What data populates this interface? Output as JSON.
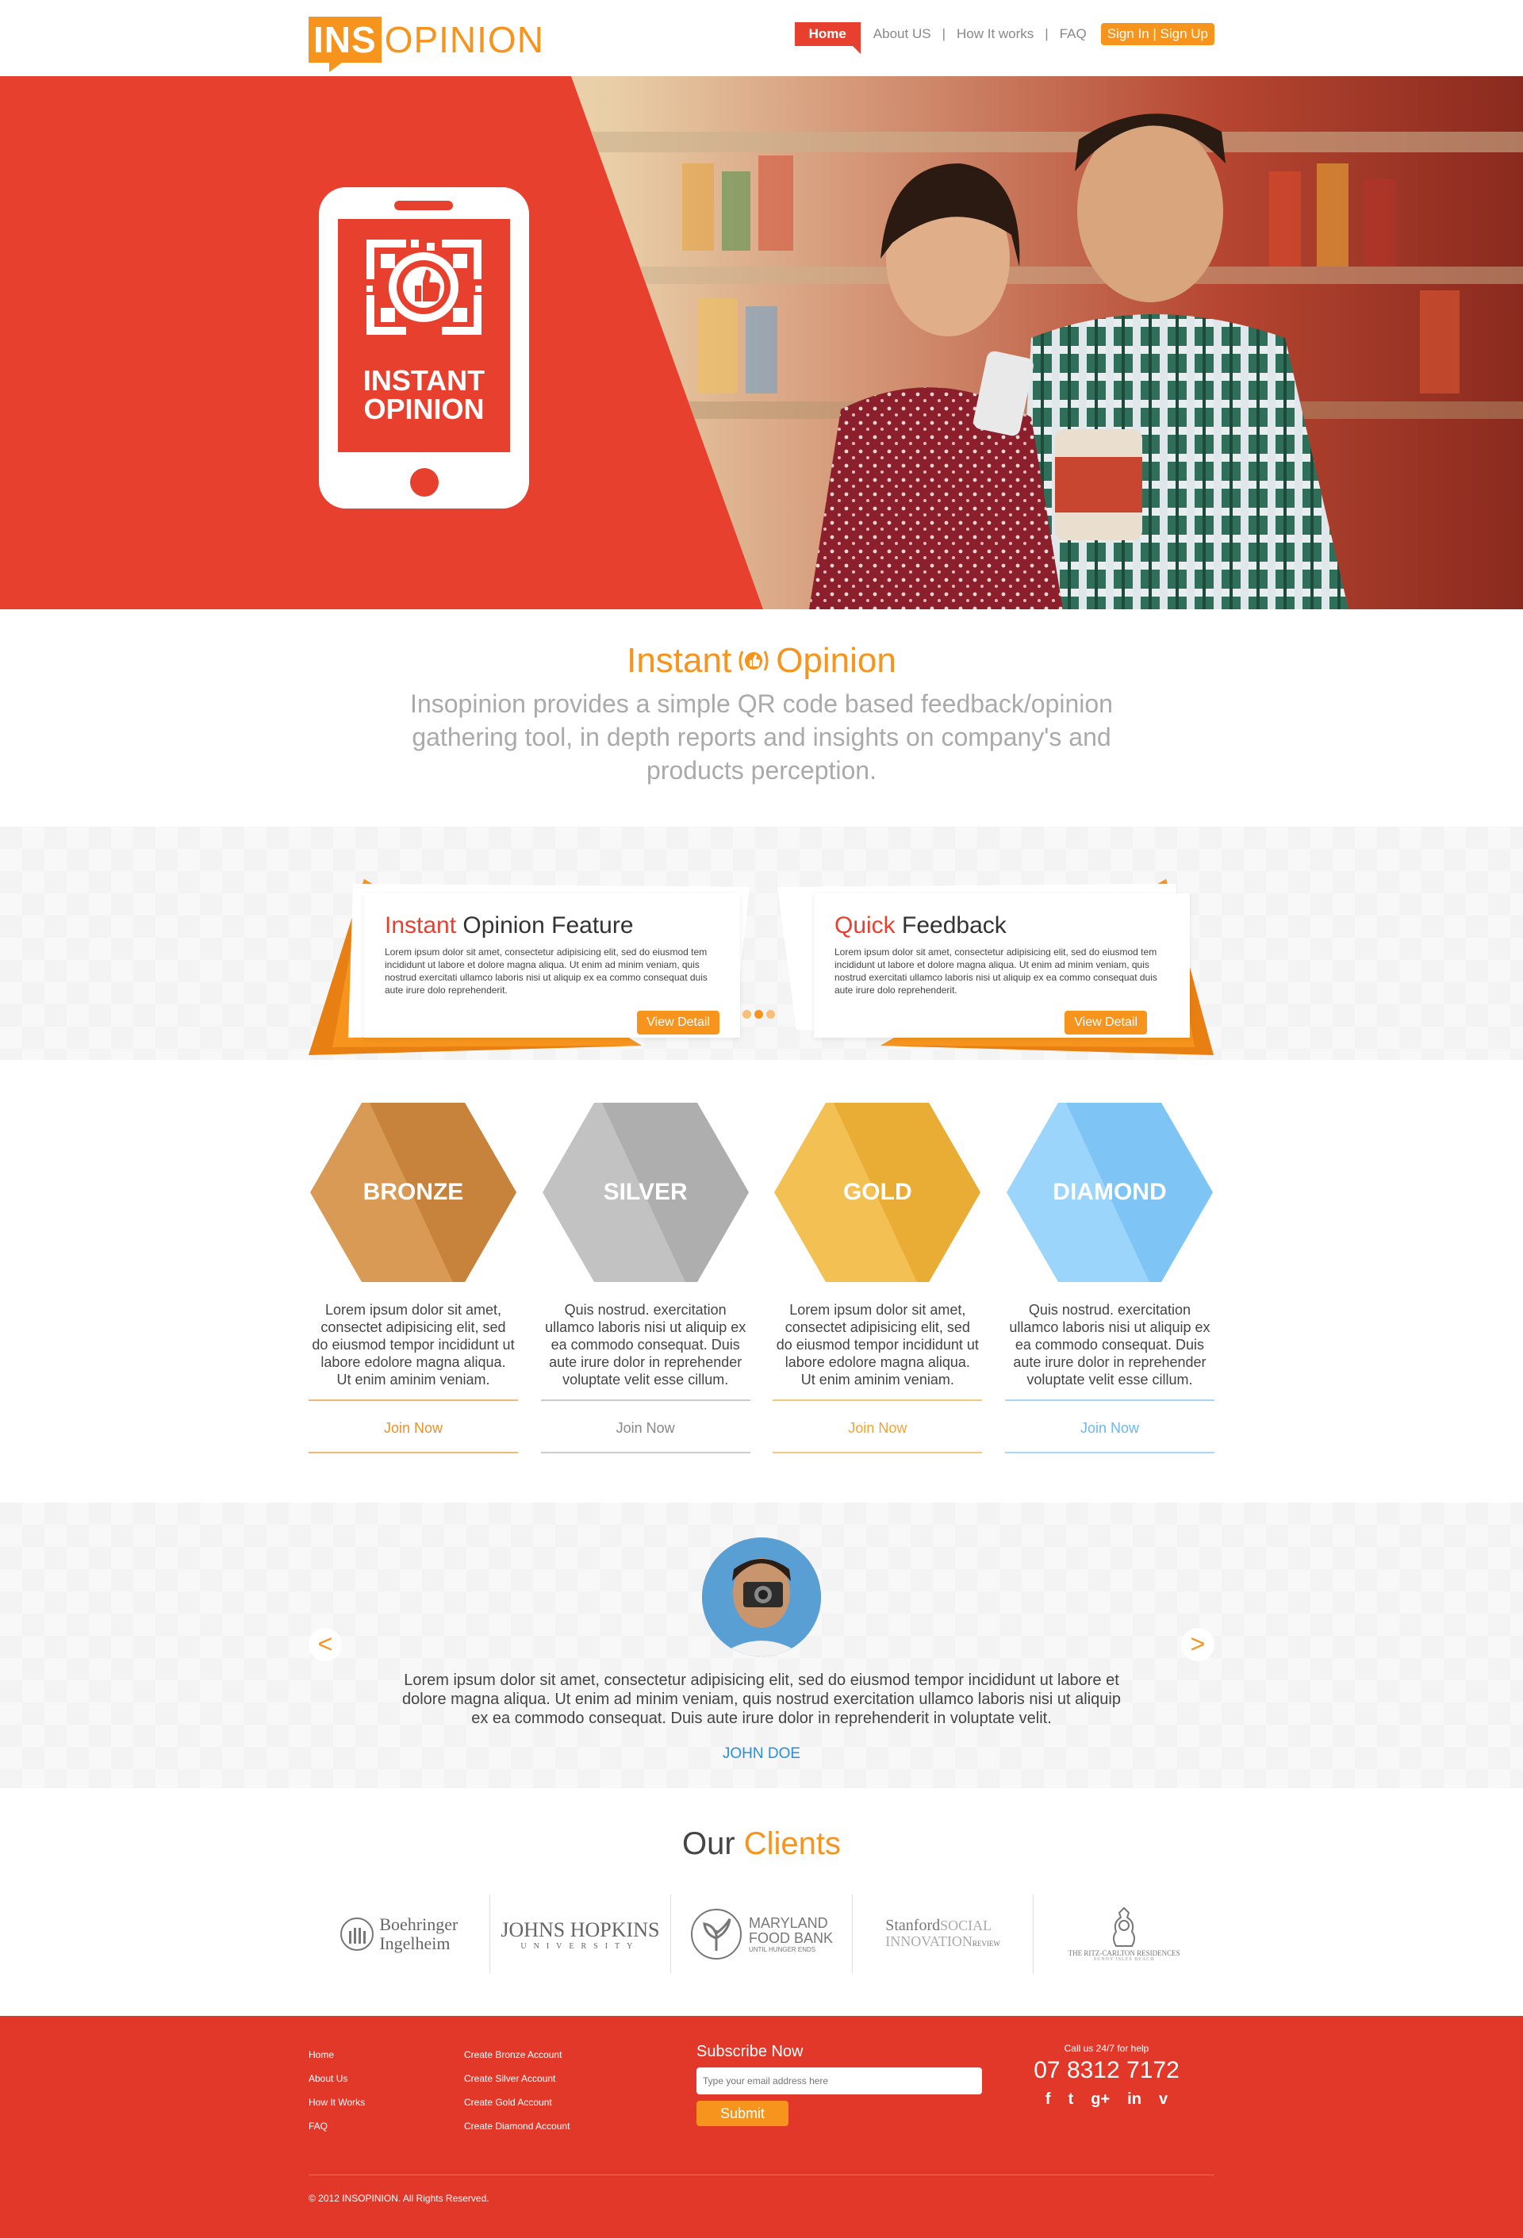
{
  "header": {
    "logo_ins": "INS",
    "logo_opinion": "OPINION",
    "nav": {
      "home": "Home",
      "about": "About US",
      "how": "How It works",
      "faq": "FAQ",
      "sep": "|",
      "sign": "Sign In | Sign Up"
    }
  },
  "hero": {
    "phone_line1": "INSTANT",
    "phone_line2": "OPINION"
  },
  "intro": {
    "title_left": "Instant",
    "title_right": "Opinion",
    "description": "Insopinion provides a simple QR code based feedback/opinion gathering tool, in depth reports and insights on company's and products perception."
  },
  "features": [
    {
      "title_highlight": "Instant",
      "title_rest": " Opinion Feature",
      "body": "Lorem ipsum dolor sit amet, consectetur adipisicing elit, sed do eiusmod tem incididunt ut labore et dolore magna aliqua. Ut enim ad minim veniam, quis nostrud exercitati ullamco laboris nisi ut aliquip ex ea commo consequat duis aute irure dolo reprehenderit.",
      "button": "View Detail"
    },
    {
      "title_highlight": "Quick",
      "title_rest": " Feedback",
      "body": "Lorem ipsum dolor sit amet, consectetur adipisicing elit, sed do eiusmod tem incididunt ut labore et dolore magna aliqua. Ut enim ad minim veniam, quis nostrud exercitati ullamco laboris nisi ut aliquip ex ea commo consequat duis aute irure dolo reprehenderit.",
      "button": "View Detail"
    }
  ],
  "plans": [
    {
      "name": "BRONZE",
      "desc": "Lorem ipsum dolor sit amet, consectet adipisicing elit, sed do eiusmod tempor incididunt ut labore edolore magna aliqua. Ut enim aminim veniam.",
      "join": "Join Now",
      "color": "#d89a55",
      "shade": "#c7823c",
      "join_color": "#e8922e",
      "line_color": "#f0b878"
    },
    {
      "name": "SILVER",
      "desc": "Quis nostrud. exercitation ullamco laboris nisi ut aliquip ex ea commodo consequat. Duis aute irure dolor in reprehender voluptate velit esse cillum.",
      "join": "Join Now",
      "color": "#c2c2c2",
      "shade": "#aeaeae",
      "join_color": "#888888",
      "line_color": "#cccccc"
    },
    {
      "name": "GOLD",
      "desc": "Lorem ipsum dolor sit amet, consectet adipisicing elit, sed do eiusmod tempor incididunt ut labore edolore magna aliqua. Ut enim aminim veniam.",
      "join": "Join Now",
      "color": "#f3c053",
      "shade": "#e9ac35",
      "join_color": "#f3a33a",
      "line_color": "#f5c882"
    },
    {
      "name": "DIAMOND",
      "desc": "Quis nostrud. exercitation ullamco laboris nisi ut aliquip ex ea commodo consequat. Duis aute irure dolor in reprehender voluptate velit esse cillum.",
      "join": "Join Now",
      "color": "#9bd5fb",
      "shade": "#7ec5f6",
      "join_color": "#6db7ef",
      "line_color": "#a8d8f5"
    }
  ],
  "testimonial": {
    "prev": "<",
    "next": ">",
    "quote": "Lorem ipsum dolor sit amet, consectetur adipisicing elit, sed do eiusmod tempor incididunt ut labore et dolore magna aliqua. Ut enim ad minim veniam, quis nostrud exercitation ullamco laboris nisi ut aliquip ex ea commodo consequat. Duis aute irure dolor in reprehenderit in voluptate velit.",
    "name": "JOHN DOE"
  },
  "clients": {
    "title_left": "Our",
    "title_right": " Clients",
    "logos": {
      "boehringer_1": "Boehringer",
      "boehringer_2": "Ingelheim",
      "jhu_1": "JOHNS HOPKINS",
      "jhu_2": "UNIVERSITY",
      "mfb_1": "MARYLAND",
      "mfb_2": "FOOD BANK",
      "mfb_3": "UNTIL HUNGER ENDS",
      "ssir_1": "Stanford",
      "ssir_2": "SOCIAL",
      "ssir_3": "INNOVATION",
      "ssir_4": "REVIEW",
      "ritz_1": "THE RITZ-CARLTON RESIDENCES",
      "ritz_2": "SUNNY ISLES BEACH"
    }
  },
  "footer": {
    "col1": [
      "Home",
      "About Us",
      "How It Works",
      "FAQ"
    ],
    "col2": [
      "Create Bronze Account",
      "Create Silver Account",
      "Create Gold Account",
      "Create Diamond Account"
    ],
    "subscribe_title": "Subscribe Now",
    "email_placeholder": "Type your email address here",
    "submit": "Submit",
    "help": "Call us 24/7 for help",
    "phone": "07 8312 7172",
    "social": [
      "f",
      "t",
      "g+",
      "in",
      "v"
    ],
    "copyright": "© 2012 INSOPINION. All Rights Reserved."
  },
  "colors": {
    "brand_red": "#e8402e",
    "brand_orange": "#f7941d"
  }
}
